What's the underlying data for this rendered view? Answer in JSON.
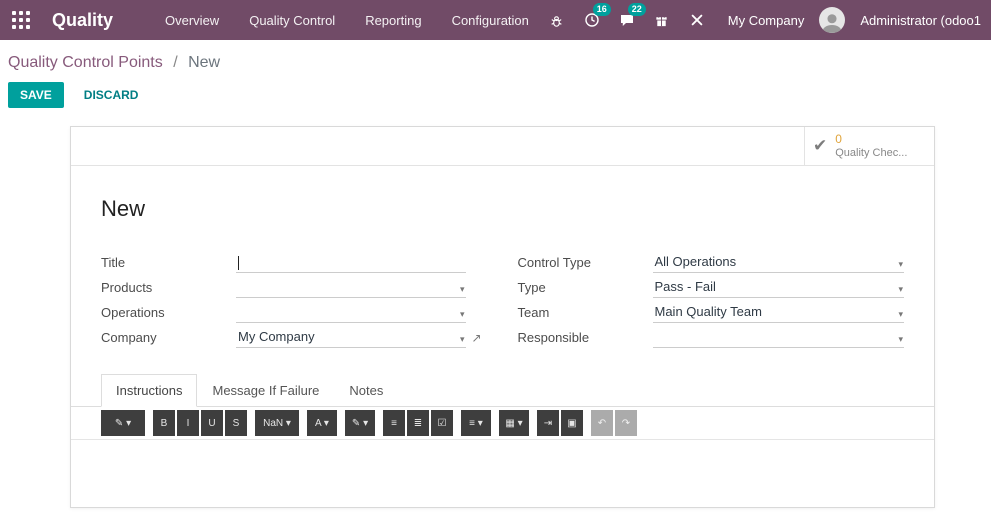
{
  "topbar": {
    "app": "Quality",
    "menu": [
      "Overview",
      "Quality Control",
      "Reporting",
      "Configuration"
    ],
    "badges": {
      "activities": "16",
      "messages": "22"
    },
    "systray_icons": [
      "bug-icon",
      "activities-icon",
      "messages-icon",
      "gift-icon",
      "tools-icon"
    ],
    "company": "My Company",
    "user": "Administrator (odoo1"
  },
  "breadcrumb": {
    "parent": "Quality Control Points",
    "separator": "/",
    "current": "New"
  },
  "actions": {
    "save": "SAVE",
    "discard": "DISCARD"
  },
  "stat_button": {
    "count": "0",
    "label": "Quality Chec..."
  },
  "form": {
    "heading": "New",
    "left_fields": [
      {
        "label": "Title",
        "value": ""
      },
      {
        "label": "Products",
        "value": ""
      },
      {
        "label": "Operations",
        "value": ""
      },
      {
        "label": "Company",
        "value": "My Company"
      }
    ],
    "right_fields": [
      {
        "label": "Control Type",
        "value": "All Operations"
      },
      {
        "label": "Type",
        "value": "Pass - Fail"
      },
      {
        "label": "Team",
        "value": "Main Quality Team"
      },
      {
        "label": "Responsible",
        "value": ""
      }
    ],
    "tabs": [
      {
        "label": "Instructions",
        "active": true
      },
      {
        "label": "Message If Failure",
        "active": false
      },
      {
        "label": "Notes",
        "active": false
      }
    ]
  },
  "editor_toolbar": {
    "buttons": [
      {
        "name": "style-dropdown",
        "glyph": "✎ ▾"
      },
      {
        "name": "bold-button",
        "glyph": "B"
      },
      {
        "name": "italic-button",
        "glyph": "I"
      },
      {
        "name": "underline-button",
        "glyph": "U"
      },
      {
        "name": "strikethrough-button",
        "glyph": "S"
      },
      {
        "name": "font-size-dropdown",
        "glyph": "NaN ▾"
      },
      {
        "name": "text-color-dropdown",
        "glyph": "A ▾"
      },
      {
        "name": "highlight-dropdown",
        "glyph": "✎ ▾"
      },
      {
        "name": "unordered-list-button",
        "glyph": "≡"
      },
      {
        "name": "ordered-list-button",
        "glyph": "≣"
      },
      {
        "name": "checklist-button",
        "glyph": "☑"
      },
      {
        "name": "align-dropdown",
        "glyph": "≡ ▾"
      },
      {
        "name": "table-dropdown",
        "glyph": "▦ ▾"
      },
      {
        "name": "indent-button",
        "glyph": "⇥"
      },
      {
        "name": "image-button",
        "glyph": "▣"
      },
      {
        "name": "undo-button",
        "glyph": "↶"
      },
      {
        "name": "redo-button",
        "glyph": "↷"
      }
    ]
  },
  "icons": {
    "check": "✔",
    "dropdown": "▾",
    "external_link": "↗"
  },
  "colors": {
    "topbar_bg": "#714B67",
    "accent_teal": "#00A09D",
    "breadcrumb_link": "#875A7B",
    "stat_count": "#E0A43B"
  }
}
